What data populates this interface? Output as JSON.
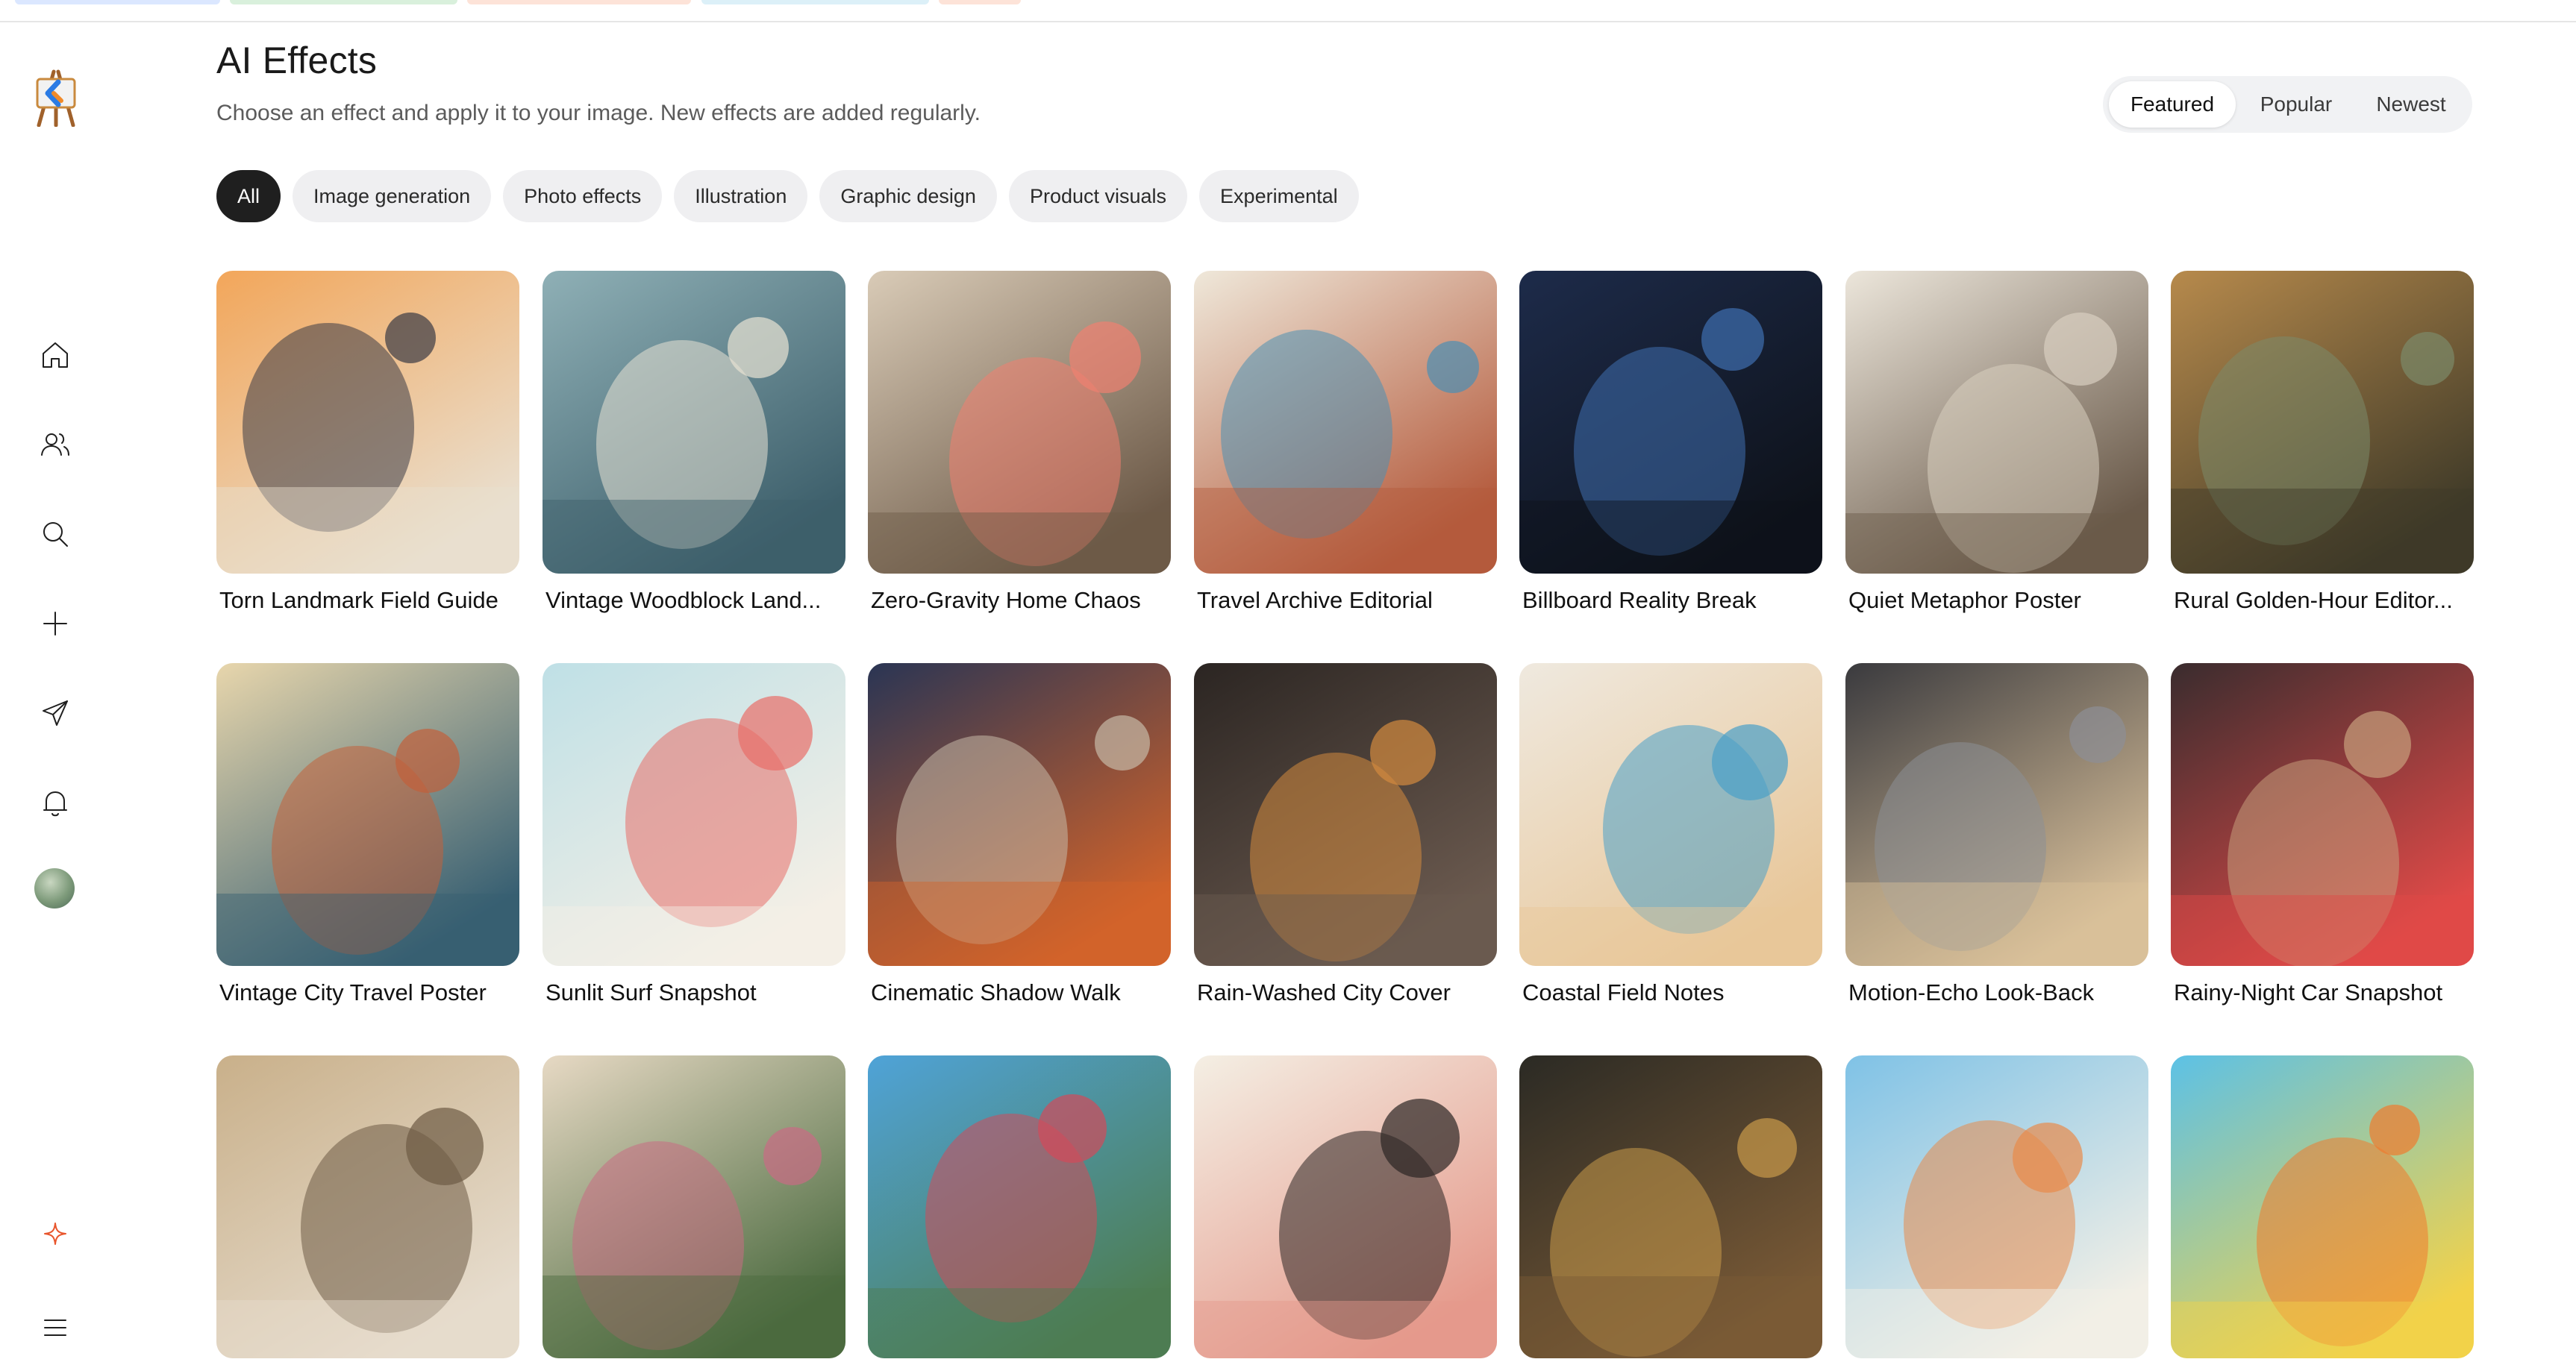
{
  "app": {
    "logo_icon": "easel-logo-icon"
  },
  "page": {
    "title": "AI Effects",
    "subtitle": "Choose an effect and apply it to your image. New effects are added regularly."
  },
  "sort": {
    "options": [
      "Featured",
      "Popular",
      "Newest"
    ],
    "selected": "Featured"
  },
  "filters": {
    "chips": [
      "All",
      "Image generation",
      "Photo effects",
      "Illustration",
      "Graphic design",
      "Product visuals",
      "Experimental"
    ],
    "selected": "All"
  },
  "sidebar": {
    "items": [
      {
        "icon": "home-icon"
      },
      {
        "icon": "people-icon"
      },
      {
        "icon": "search-icon"
      },
      {
        "icon": "plus-icon"
      },
      {
        "icon": "send-icon"
      },
      {
        "icon": "bell-icon"
      }
    ],
    "bottom": [
      {
        "icon": "sparkle-icon"
      },
      {
        "icon": "menu-icon"
      }
    ]
  },
  "effects": [
    {
      "label": "Torn Landmark Field Guide",
      "palette": [
        "#f2a65a",
        "#3a3a45",
        "#e9dfcf"
      ]
    },
    {
      "label": "Vintage Woodblock Land...",
      "palette": [
        "#8fb0b6",
        "#e8e2d3",
        "#3d5f6b"
      ]
    },
    {
      "label": "Zero-Gravity Home Chaos",
      "palette": [
        "#d9cbb7",
        "#f08070",
        "#6d5a48"
      ]
    },
    {
      "label": "Travel Archive Editorial",
      "palette": [
        "#efe8da",
        "#4c8fb3",
        "#b45a3c"
      ]
    },
    {
      "label": "Billboard Reality Break",
      "palette": [
        "#1d2b4a",
        "#3f6fb0",
        "#0e121a"
      ]
    },
    {
      "label": "Quiet Metaphor Poster",
      "palette": [
        "#ece6db",
        "#d8cfc0",
        "#6a5a4a"
      ]
    },
    {
      "label": "Rural Golden-Hour Editor...",
      "palette": [
        "#b78a4c",
        "#7c8a6a",
        "#3f3a28"
      ]
    },
    {
      "label": "Vintage City Travel Poster",
      "palette": [
        "#e8d6ac",
        "#c2603a",
        "#375f72"
      ]
    },
    {
      "label": "Sunlit Surf Snapshot",
      "palette": [
        "#bfe0e6",
        "#e86d68",
        "#f4efe6"
      ]
    },
    {
      "label": "Cinematic Shadow Walk",
      "palette": [
        "#2a3554",
        "#c6b9a7",
        "#d2632a"
      ]
    },
    {
      "label": "Rain-Washed City Cover",
      "palette": [
        "#2b2522",
        "#d38a3e",
        "#6b5a4f"
      ]
    },
    {
      "label": "Coastal Field Notes",
      "palette": [
        "#efe9df",
        "#4aa0c8",
        "#e8c79a"
      ]
    },
    {
      "label": "Motion-Echo Look-Back",
      "palette": [
        "#3a3a3e",
        "#8d8f96",
        "#d9c09a"
      ]
    },
    {
      "label": "Rainy-Night Car Snapshot",
      "palette": [
        "#3a2c2e",
        "#c79f7c",
        "#e04a48"
      ]
    },
    {
      "label": "",
      "palette": [
        "#c9b08a",
        "#6d5b45",
        "#e6dccd"
      ]
    },
    {
      "label": "",
      "palette": [
        "#e7d9c4",
        "#c96b84",
        "#4b6a3f"
      ]
    },
    {
      "label": "",
      "palette": [
        "#4fa3d8",
        "#d24a5a",
        "#4e7d52"
      ]
    },
    {
      "label": "",
      "palette": [
        "#f4efe4",
        "#2b2523",
        "#e59a8c"
      ]
    },
    {
      "label": "",
      "palette": [
        "#2b2a24",
        "#c99a4a",
        "#7a5a36"
      ]
    },
    {
      "label": "",
      "palette": [
        "#7fc2e6",
        "#e88a4a",
        "#f2efe6"
      ]
    },
    {
      "label": "",
      "palette": [
        "#5cc1e6",
        "#f07a2e",
        "#f2d24a"
      ]
    }
  ]
}
